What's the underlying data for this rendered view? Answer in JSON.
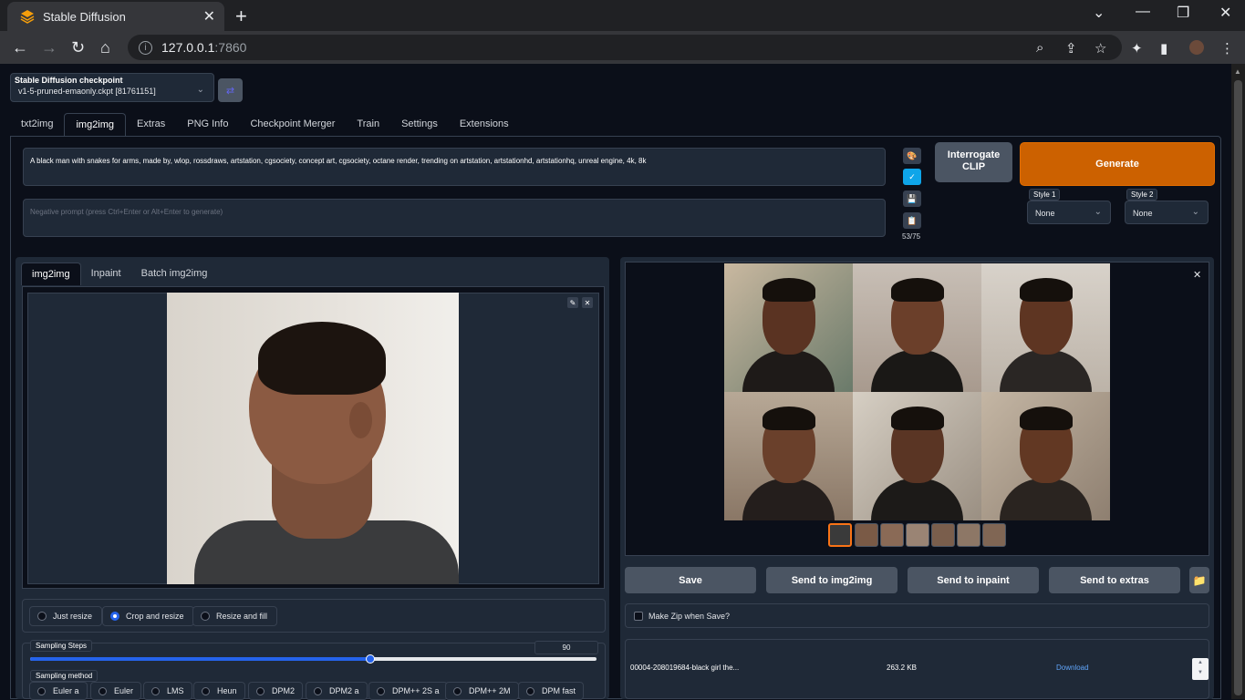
{
  "browser": {
    "tab_title": "Stable Diffusion",
    "url_host": "127.0.0.1",
    "url_port": ":7860"
  },
  "checkpoint": {
    "label": "Stable Diffusion checkpoint",
    "value": "v1-5-pruned-emaonly.ckpt [81761151]"
  },
  "main_tabs": [
    "txt2img",
    "img2img",
    "Extras",
    "PNG Info",
    "Checkpoint Merger",
    "Train",
    "Settings",
    "Extensions"
  ],
  "prompt": {
    "text": "A black man with snakes for arms, made by, wlop, rossdraws, artstation, cgsociety, concept art, cgsociety, octane render, trending on artstation, artstationhd, artstationhq, unreal engine, 4k, 8k",
    "negative_placeholder": "Negative prompt (press Ctrl+Enter or Alt+Enter to generate)",
    "token_count": "53/75"
  },
  "buttons": {
    "interrogate_line1": "Interrogate",
    "interrogate_line2": "CLIP",
    "generate": "Generate"
  },
  "styles": [
    {
      "label": "Style 1",
      "value": "None"
    },
    {
      "label": "Style 2",
      "value": "None"
    }
  ],
  "sub_tabs": [
    "img2img",
    "Inpaint",
    "Batch img2img"
  ],
  "resize_modes": [
    "Just resize",
    "Crop and resize",
    "Resize and fill"
  ],
  "resize_selected": "Crop and resize",
  "sampling": {
    "steps_label": "Sampling Steps",
    "steps_value": "90",
    "steps_fraction": 0.6,
    "method_label": "Sampling method",
    "methods": [
      "Euler a",
      "Euler",
      "LMS",
      "Heun",
      "DPM2",
      "DPM2 a",
      "DPM++ 2S a",
      "DPM++ 2M",
      "DPM fast"
    ]
  },
  "output_actions": [
    "Save",
    "Send to img2img",
    "Send to inpaint",
    "Send to extras"
  ],
  "zip_label": "Make Zip when Save?",
  "file": {
    "name": "00004-208019684-black girl the...",
    "size": "263.2 KB",
    "download": "Download"
  },
  "colors": {
    "accent": "#cc6100",
    "slider": "#2563eb",
    "background": "#0b0f19"
  }
}
